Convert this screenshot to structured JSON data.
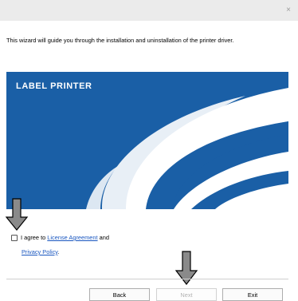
{
  "window": {
    "close_glyph": "×"
  },
  "intro_text": "This wizard will guide you through the installation and uninstallation of the printer driver.",
  "banner": {
    "title": "LABEL PRINTER",
    "colors": {
      "blue": "#1a5fa6",
      "white": "#ffffff"
    }
  },
  "agreement": {
    "prefix": "I agree to",
    "license_link": "License Agreement",
    "middle": "and",
    "privacy_link": "Privacy Policy",
    "suffix": ".",
    "checked": false
  },
  "buttons": {
    "back": "Back",
    "next": "Next",
    "exit": "Exit"
  },
  "arrow_color": "#8a8a8a"
}
